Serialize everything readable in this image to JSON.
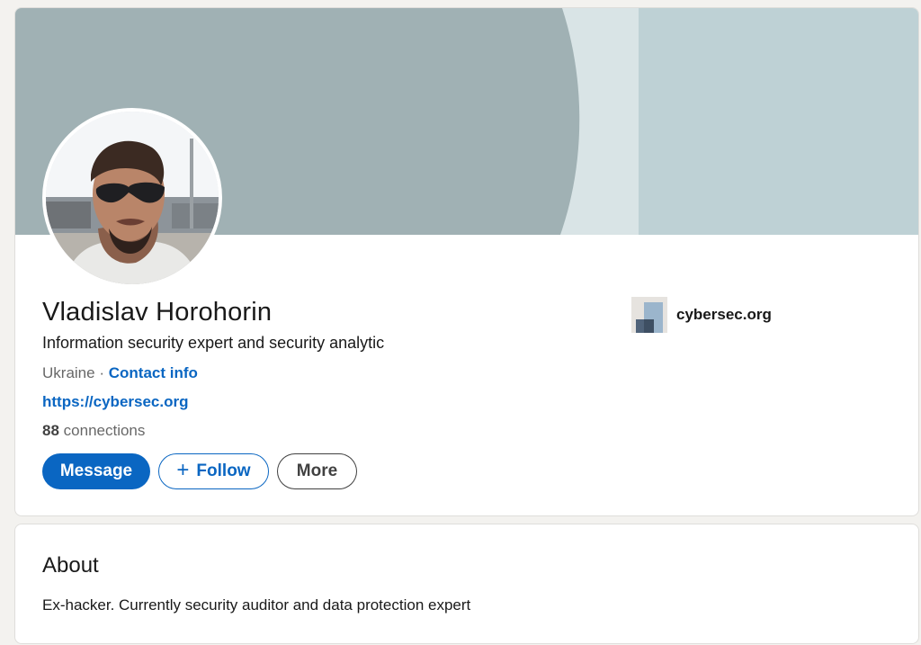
{
  "profile": {
    "name": "Vladislav Horohorin",
    "headline": "Information security expert and security analytic",
    "location": "Ukraine",
    "separator": "·",
    "contact_info_label": "Contact info",
    "website": "https://cybersec.org",
    "connections_count": "88",
    "connections_label": "connections",
    "avatar_icon": "profile-photo"
  },
  "actions": {
    "message_label": "Message",
    "follow_icon": "plus-icon",
    "follow_plus": "+",
    "follow_label": "Follow",
    "more_label": "More"
  },
  "organization": {
    "name": "cybersec.org",
    "logo_icon": "company-logo"
  },
  "about": {
    "title": "About",
    "text": "Ex-hacker. Currently security auditor and data protection expert"
  },
  "colors": {
    "accent": "#0a66c2",
    "banner_dark": "#a0b1b4",
    "banner_mid": "#d9e4e6",
    "banner_light": "#bed1d5",
    "page_bg": "#f3f2ef"
  }
}
